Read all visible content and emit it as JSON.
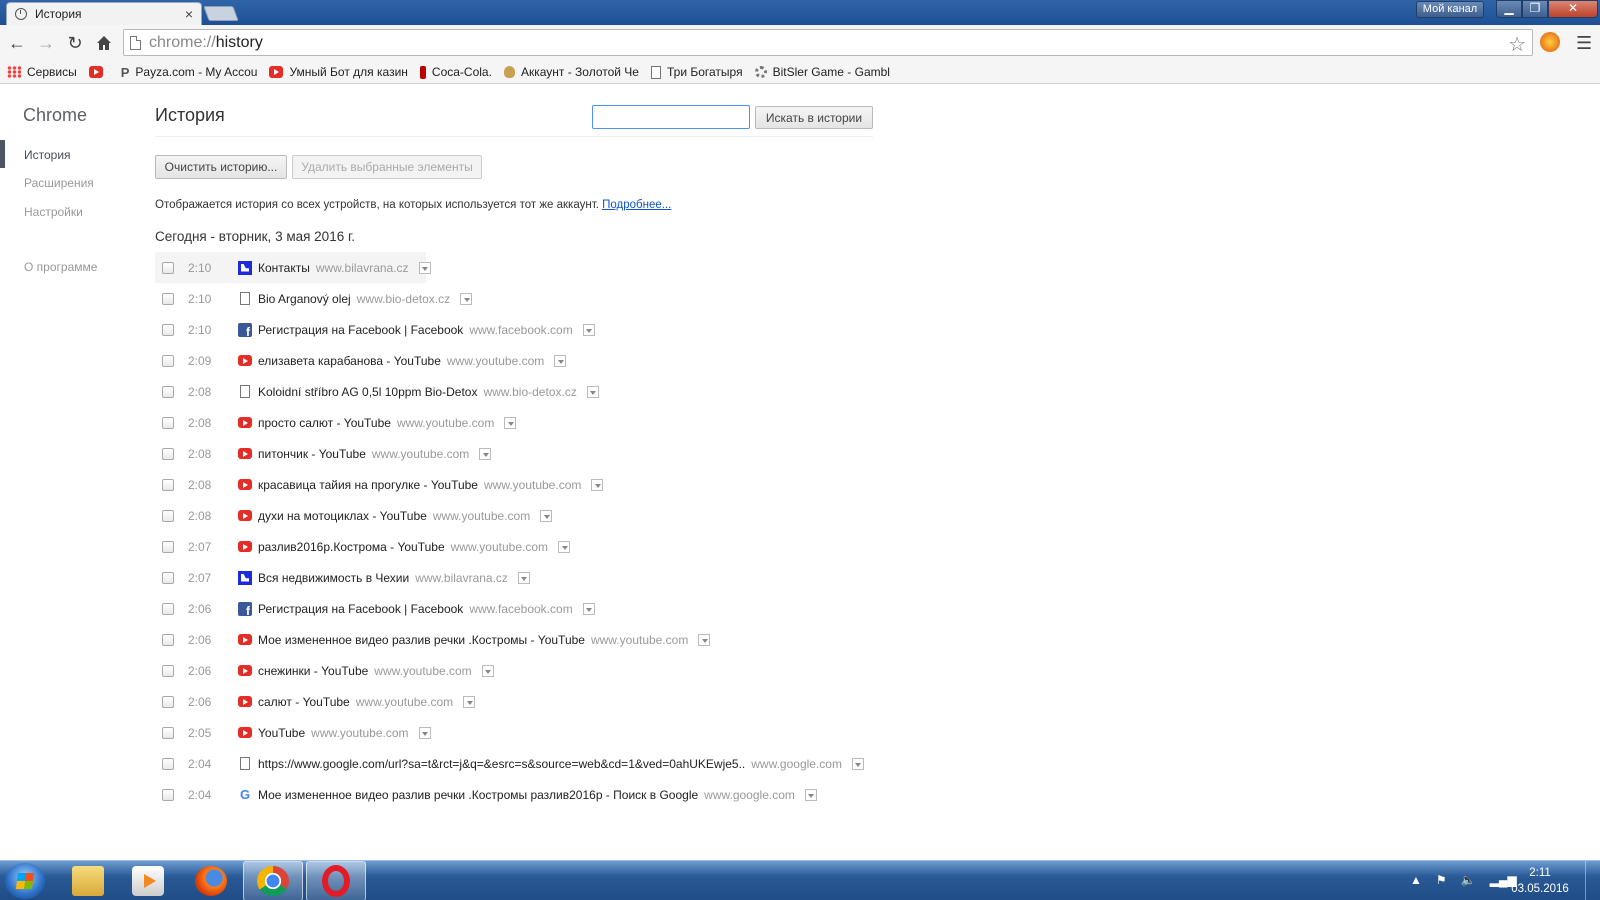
{
  "window": {
    "tab_title": "История",
    "channel_button": "Мой канал",
    "minimize": "▁",
    "maximize": "❐",
    "close": "✕"
  },
  "toolbar": {
    "url_scheme": "chrome://",
    "url_path": "history"
  },
  "bookmarks": [
    {
      "label": "Сервисы",
      "icon": "apps-icon"
    },
    {
      "label": "",
      "icon": "youtube-icon"
    },
    {
      "label": "Payza.com - My Accou",
      "icon": "payza-icon"
    },
    {
      "label": "Умный Бот для казин",
      "icon": "youtube-icon"
    },
    {
      "label": "Coca-Cola.",
      "icon": "cola-icon"
    },
    {
      "label": "Аккаунт - Золотой Че",
      "icon": "bag-icon"
    },
    {
      "label": "Три Богатыря",
      "icon": "page-icon"
    },
    {
      "label": "BitSler Game - Gambl",
      "icon": "gear-icon"
    }
  ],
  "sidebar": {
    "brand": "Chrome",
    "items": [
      {
        "label": "История",
        "active": true
      },
      {
        "label": "Расширения"
      },
      {
        "label": "Настройки"
      },
      {
        "label": "О программе"
      }
    ]
  },
  "main": {
    "title": "История",
    "search_value": "",
    "search_button": "Искать в истории",
    "clear_button": "Очистить историю...",
    "remove_button": "Удалить выбранные элементы",
    "sync_note": "Отображается история со всех устройств, на которых используется тот же аккаунт.",
    "sync_link": "Подробнее...",
    "day_header": "Сегодня - вторник, 3 мая 2016 г."
  },
  "entries": [
    {
      "time": "2:10",
      "title": "Контакты",
      "domain": "www.bilavrana.cz",
      "icon": "bilavrana"
    },
    {
      "time": "2:10",
      "title": "Bio Arganový olej",
      "domain": "www.bio-detox.cz",
      "icon": "page"
    },
    {
      "time": "2:10",
      "title": "Регистрация на Facebook | Facebook",
      "domain": "www.facebook.com",
      "icon": "facebook"
    },
    {
      "time": "2:09",
      "title": "елизавета карабанова - YouTube",
      "domain": "www.youtube.com",
      "icon": "youtube"
    },
    {
      "time": "2:08",
      "title": "Koloidní stříbro AG 0,5l 10ppm Bio-Detox",
      "domain": "www.bio-detox.cz",
      "icon": "page"
    },
    {
      "time": "2:08",
      "title": "просто салют - YouTube",
      "domain": "www.youtube.com",
      "icon": "youtube"
    },
    {
      "time": "2:08",
      "title": "питончик - YouTube",
      "domain": "www.youtube.com",
      "icon": "youtube"
    },
    {
      "time": "2:08",
      "title": "красавица тайия на прогулке - YouTube",
      "domain": "www.youtube.com",
      "icon": "youtube"
    },
    {
      "time": "2:08",
      "title": "духи на мотоциклах - YouTube",
      "domain": "www.youtube.com",
      "icon": "youtube"
    },
    {
      "time": "2:07",
      "title": "разлив2016р.Кострома - YouTube",
      "domain": "www.youtube.com",
      "icon": "youtube"
    },
    {
      "time": "2:07",
      "title": "Вся недвижимость в Чехии",
      "domain": "www.bilavrana.cz",
      "icon": "bilavrana"
    },
    {
      "time": "2:06",
      "title": "Регистрация на Facebook | Facebook",
      "domain": "www.facebook.com",
      "icon": "facebook"
    },
    {
      "time": "2:06",
      "title": "Мое измененное видео разлив речки .Костромы - YouTube",
      "domain": "www.youtube.com",
      "icon": "youtube"
    },
    {
      "time": "2:06",
      "title": "снежинки - YouTube",
      "domain": "www.youtube.com",
      "icon": "youtube"
    },
    {
      "time": "2:06",
      "title": "салют - YouTube",
      "domain": "www.youtube.com",
      "icon": "youtube"
    },
    {
      "time": "2:05",
      "title": "YouTube",
      "domain": "www.youtube.com",
      "icon": "youtube"
    },
    {
      "time": "2:04",
      "title": "https://www.google.com/url?sa=t&rct=j&q=&esrc=s&source=web&cd=1&ved=0ahUKEwje5..",
      "domain": "www.google.com",
      "icon": "page"
    },
    {
      "time": "2:04",
      "title": "Мое измененное видео разлив речки .Костромы разлив2016р - Поиск в Google",
      "domain": "www.google.com",
      "icon": "google"
    }
  ],
  "taskbar": {
    "clock_time": "2:11",
    "clock_date": "03.05.2016"
  }
}
